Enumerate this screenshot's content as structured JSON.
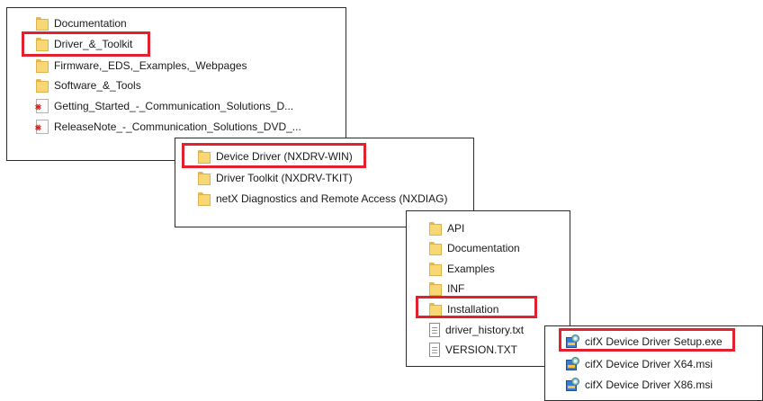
{
  "panels": [
    {
      "items": [
        {
          "icon": "folder-icon",
          "label": "Documentation"
        },
        {
          "icon": "folder-icon",
          "label": "Driver_&_Toolkit"
        },
        {
          "icon": "folder-icon",
          "label": "Firmware,_EDS,_Examples,_Webpages"
        },
        {
          "icon": "folder-icon",
          "label": "Software_&_Tools"
        },
        {
          "icon": "pdf-icon",
          "label": "Getting_Started_-_Communication_Solutions_D..."
        },
        {
          "icon": "pdf-icon",
          "label": "ReleaseNote_-_Communication_Solutions_DVD_..."
        }
      ]
    },
    {
      "items": [
        {
          "icon": "folder-icon",
          "label": "Device Driver (NXDRV-WIN)"
        },
        {
          "icon": "folder-icon",
          "label": "Driver Toolkit (NXDRV-TKIT)"
        },
        {
          "icon": "folder-icon",
          "label": "netX Diagnostics and Remote Access (NXDIAG)"
        }
      ]
    },
    {
      "items": [
        {
          "icon": "folder-icon",
          "label": "API"
        },
        {
          "icon": "folder-icon",
          "label": "Documentation"
        },
        {
          "icon": "folder-icon",
          "label": "Examples"
        },
        {
          "icon": "folder-icon",
          "label": "INF"
        },
        {
          "icon": "folder-icon",
          "label": "Installation"
        },
        {
          "icon": "text-file-icon",
          "label": "driver_history.txt"
        },
        {
          "icon": "text-file-icon",
          "label": "VERSION.TXT"
        }
      ]
    },
    {
      "items": [
        {
          "icon": "installer-icon",
          "label": "cifX Device Driver Setup.exe"
        },
        {
          "icon": "installer-icon",
          "label": "cifX Device Driver X64.msi"
        },
        {
          "icon": "installer-icon",
          "label": "cifX Device Driver X86.msi"
        }
      ]
    }
  ],
  "highlight_color": "#e3202e",
  "folder_color": "#f8d775"
}
